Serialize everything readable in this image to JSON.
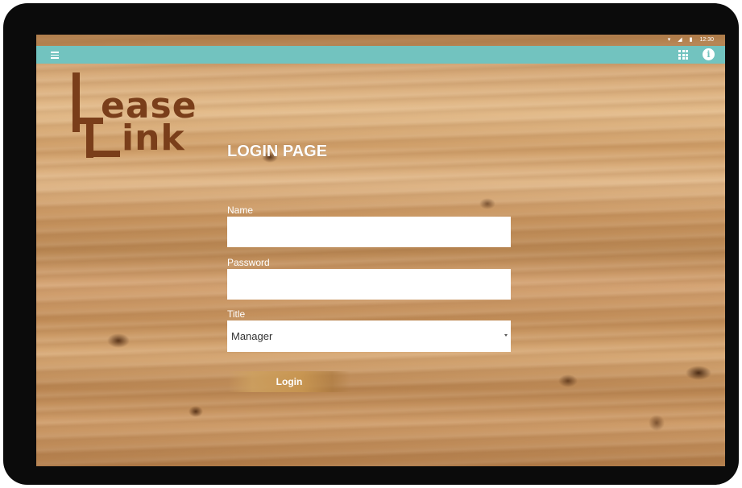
{
  "status_bar": {
    "icons": [
      "wifi-icon",
      "signal-icon",
      "battery-icon"
    ],
    "time": "12:30"
  },
  "app_bar": {
    "color": "#72c3bf",
    "left_icon": "menu-icon",
    "right_icons": [
      "apps-grid-icon",
      "info-icon"
    ],
    "info_glyph": "i"
  },
  "logo": {
    "line1": "ease",
    "line2": "ink",
    "color": "#7a3e1a"
  },
  "page_title": "LOGIN PAGE",
  "form": {
    "name_label": "Name",
    "name_value": "",
    "password_label": "Password",
    "password_value": "",
    "title_label": "Title",
    "title_selected": "Manager",
    "login_label": "Login"
  }
}
